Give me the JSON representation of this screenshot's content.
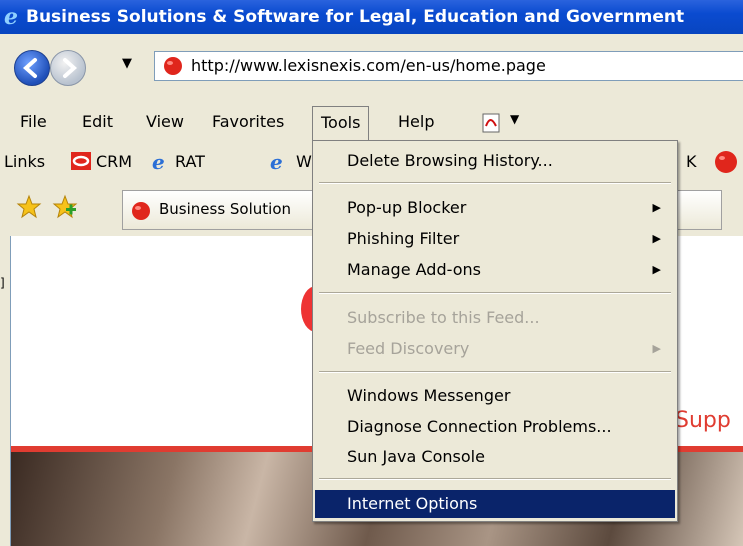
{
  "window": {
    "title": "Business Solutions & Software for Legal, Education and Government"
  },
  "address": {
    "url": "http://www.lexisnexis.com/en-us/home.page"
  },
  "menubar": {
    "items": [
      "File",
      "Edit",
      "View",
      "Favorites",
      "Tools",
      "Help"
    ],
    "active": "Tools"
  },
  "links_bar": {
    "label": "Links",
    "items": [
      "CRM",
      "RAT",
      "W",
      "K"
    ]
  },
  "tabs": [
    {
      "title": "Business Solution"
    }
  ],
  "content": {
    "partial_text": "Supp"
  },
  "tools_menu": {
    "items": [
      {
        "label": "Delete Browsing History...",
        "enabled": true,
        "submenu": false
      },
      {
        "label": "Pop-up Blocker",
        "enabled": true,
        "submenu": true
      },
      {
        "label": "Phishing Filter",
        "enabled": true,
        "submenu": true
      },
      {
        "label": "Manage Add-ons",
        "enabled": true,
        "submenu": true
      },
      {
        "label": "Subscribe to this Feed...",
        "enabled": false,
        "submenu": false
      },
      {
        "label": "Feed Discovery",
        "enabled": false,
        "submenu": true
      },
      {
        "label": "Windows Messenger",
        "enabled": true,
        "submenu": false
      },
      {
        "label": "Diagnose Connection Problems...",
        "enabled": true,
        "submenu": false
      },
      {
        "label": "Sun Java Console",
        "enabled": true,
        "submenu": false
      },
      {
        "label": "Internet Options",
        "enabled": true,
        "submenu": false,
        "highlighted": true
      }
    ]
  },
  "colors": {
    "titlebar": "#0a4bd0",
    "menu_highlight": "#0a246a",
    "accent_red": "#e03c31"
  },
  "icons": [
    "ie-logo-icon",
    "back-icon",
    "forward-icon",
    "red-globe-icon",
    "pdf-icon",
    "crm-icon",
    "ie-page-icon",
    "favorites-star-icon",
    "add-favorite-icon"
  ]
}
